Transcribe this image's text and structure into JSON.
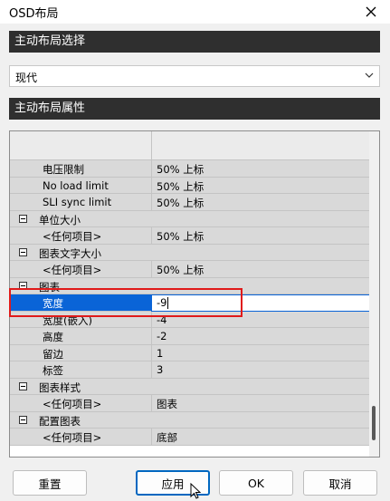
{
  "window": {
    "title": "OSD布局"
  },
  "section_layout": {
    "label": "主动布局选择"
  },
  "layout_combo": {
    "value": "现代"
  },
  "section_props": {
    "label": "主动布局属性"
  },
  "rows": [
    {
      "type": "top",
      "label": "",
      "value": ""
    },
    {
      "type": "prop",
      "label": "电压限制",
      "value": "50% 上标"
    },
    {
      "type": "prop",
      "label": "No load limit",
      "value": "50% 上标"
    },
    {
      "type": "prop",
      "label": "SLI sync limit",
      "value": "50% 上标"
    },
    {
      "type": "cat",
      "label": "单位大小",
      "value": ""
    },
    {
      "type": "prop",
      "label": "<任何项目>",
      "value": "50% 上标"
    },
    {
      "type": "cat",
      "label": "图表文字大小",
      "value": ""
    },
    {
      "type": "prop",
      "label": "<任何项目>",
      "value": "50% 上标"
    },
    {
      "type": "cat",
      "label": "图表",
      "value": ""
    },
    {
      "type": "sel",
      "label": "宽度",
      "value": "-9"
    },
    {
      "type": "prop",
      "label": "宽度(嵌入)",
      "value": "-4"
    },
    {
      "type": "prop",
      "label": "高度",
      "value": "-2"
    },
    {
      "type": "prop",
      "label": "留边",
      "value": "1"
    },
    {
      "type": "prop",
      "label": "标签",
      "value": "3"
    },
    {
      "type": "cat",
      "label": "图表样式",
      "value": ""
    },
    {
      "type": "prop",
      "label": "<任何项目>",
      "value": "图表"
    },
    {
      "type": "cat",
      "label": "配置图表",
      "value": ""
    },
    {
      "type": "prop",
      "label": "<任何项目>",
      "value": "底部"
    }
  ],
  "buttons": {
    "reset": "重置",
    "apply": "应用",
    "ok": "OK",
    "cancel": "取消"
  },
  "icons": {
    "close": "close-icon",
    "dropdown": "chevron-down-icon",
    "collapse": "minus-box-icon",
    "cursor": "mouse-pointer-icon"
  },
  "colors": {
    "section_bg": "#2f2f2f",
    "selection": "#0a64d7",
    "highlight_box": "#e01a1a",
    "primary_button": "#0067c0"
  }
}
